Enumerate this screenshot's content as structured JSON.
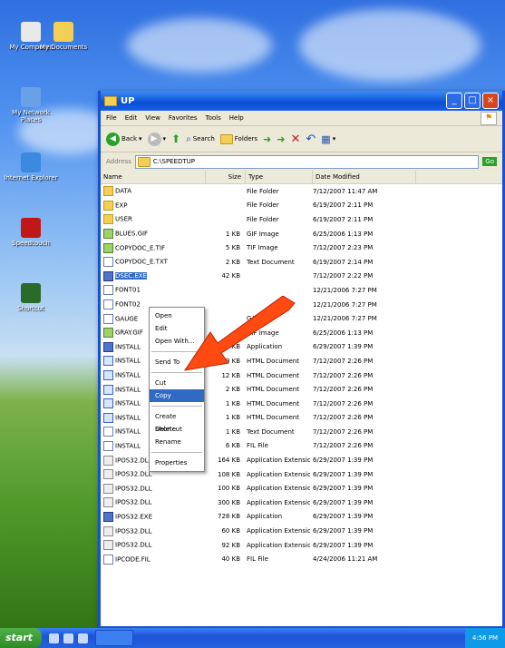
{
  "desktop": {
    "icons": [
      {
        "label": "My Computer",
        "color": "#e9e9e9"
      },
      {
        "label": "My Documents",
        "color": "#f4cf55"
      },
      {
        "label": "My Network Places",
        "color": "#6aa0e8"
      },
      {
        "label": "Internet Explorer",
        "color": "#3c8ae0"
      },
      {
        "label": "Speedtouch",
        "color": "#c01818"
      },
      {
        "label": "Shortcut",
        "color": "#2a6a2a"
      }
    ]
  },
  "window": {
    "title": "UP",
    "menu": [
      "File",
      "Edit",
      "View",
      "Favorites",
      "Tools",
      "Help"
    ],
    "toolbar": {
      "back": "Back",
      "search": "Search",
      "folders": "Folders"
    },
    "address_label": "Address",
    "address_value": "C:\\SPEEDTUP",
    "go_label": "Go",
    "columns": [
      "Name",
      "Size",
      "Type",
      "Date Modified"
    ],
    "files": [
      {
        "name": "DATA",
        "size": "",
        "type": "File Folder",
        "date": "7/12/2007 11:47 AM",
        "icon": "folder"
      },
      {
        "name": "EXP",
        "size": "",
        "type": "File Folder",
        "date": "6/19/2007 2:11 PM",
        "icon": "folder"
      },
      {
        "name": "USER",
        "size": "",
        "type": "File Folder",
        "date": "6/19/2007 2:11 PM",
        "icon": "folder"
      },
      {
        "name": "BLUES.GIF",
        "size": "1 KB",
        "type": "GIF Image",
        "date": "6/25/2006 1:13 PM",
        "icon": "img"
      },
      {
        "name": "COPYDOC_E.TIF",
        "size": "5 KB",
        "type": "TIF Image",
        "date": "7/12/2007 2:23 PM",
        "icon": "img"
      },
      {
        "name": "COPYDOC_E.TXT",
        "size": "2 KB",
        "type": "Text Document",
        "date": "6/19/2007 2:14 PM",
        "icon": "txt"
      },
      {
        "name": "DSEC.EXE",
        "size": "42 KB",
        "type": "",
        "date": "7/12/2007 2:22 PM",
        "icon": "app"
      },
      {
        "name": "FONT01",
        "size": "",
        "type": "",
        "date": "12/21/2006 7:27 PM",
        "icon": "txt"
      },
      {
        "name": "FONT02",
        "size": "",
        "type": "",
        "date": "12/21/2006 7:27 PM",
        "icon": "txt"
      },
      {
        "name": "GAUGE",
        "size": "",
        "type": "GAI File",
        "date": "12/21/2006 7:27 PM",
        "icon": "txt"
      },
      {
        "name": "GRAY.GIF",
        "size": "",
        "type": "GIF Image",
        "date": "6/25/2006 1:13 PM",
        "icon": "img"
      },
      {
        "name": "INSTALL",
        "size": "744 KB",
        "type": "Application",
        "date": "6/29/2007 1:39 PM",
        "icon": "app"
      },
      {
        "name": "INSTALL",
        "size": "19 KB",
        "type": "HTML Document",
        "date": "7/12/2007 2:26 PM",
        "icon": "htm"
      },
      {
        "name": "INSTALL",
        "size": "12 KB",
        "type": "HTML Document",
        "date": "7/12/2007 2:26 PM",
        "icon": "htm"
      },
      {
        "name": "INSTALL",
        "size": "2 KB",
        "type": "HTML Document",
        "date": "7/12/2007 2:26 PM",
        "icon": "htm"
      },
      {
        "name": "INSTALL",
        "size": "1 KB",
        "type": "HTML Document",
        "date": "7/12/2007 2:26 PM",
        "icon": "htm"
      },
      {
        "name": "INSTALL",
        "size": "1 KB",
        "type": "HTML Document",
        "date": "7/12/2007 2:26 PM",
        "icon": "htm"
      },
      {
        "name": "INSTALL",
        "size": "1 KB",
        "type": "Text Document",
        "date": "7/12/2007 2:26 PM",
        "icon": "txt"
      },
      {
        "name": "INSTALL",
        "size": "6 KB",
        "type": "FIL File",
        "date": "7/12/2007 2:26 PM",
        "icon": "txt"
      },
      {
        "name": "IPOS32.DLL",
        "size": "164 KB",
        "type": "Application Extension",
        "date": "6/29/2007 1:39 PM",
        "icon": "dll"
      },
      {
        "name": "IPOS32.DLL",
        "size": "108 KB",
        "type": "Application Extension",
        "date": "6/29/2007 1:39 PM",
        "icon": "dll"
      },
      {
        "name": "IPOS32.DLL",
        "size": "100 KB",
        "type": "Application Extension",
        "date": "6/29/2007 1:39 PM",
        "icon": "dll"
      },
      {
        "name": "IPOS32.DLL",
        "size": "300 KB",
        "type": "Application Extension",
        "date": "6/29/2007 1:39 PM",
        "icon": "dll"
      },
      {
        "name": "IPOS32.EXE",
        "size": "728 KB",
        "type": "Application",
        "date": "6/29/2007 1:39 PM",
        "icon": "app"
      },
      {
        "name": "IPOS32.DLL",
        "size": "60 KB",
        "type": "Application Extension",
        "date": "6/29/2007 1:39 PM",
        "icon": "dll"
      },
      {
        "name": "IPOS32.DLL",
        "size": "92 KB",
        "type": "Application Extension",
        "date": "6/29/2007 1:39 PM",
        "icon": "dll"
      },
      {
        "name": "IPCODE.FIL",
        "size": "40 KB",
        "type": "FIL File",
        "date": "4/24/2006 11:21 AM",
        "icon": "txt"
      }
    ],
    "selected_row": 6
  },
  "context_menu": {
    "items": [
      "Open",
      "Edit",
      "Open With...",
      "—",
      "Send To",
      "—",
      "Cut",
      "Copy",
      "—",
      "Create Shortcut",
      "Delete",
      "Rename",
      "—",
      "Properties"
    ],
    "highlighted": "Copy"
  },
  "annotation": {
    "arrow_color": "#ff4a12"
  },
  "taskbar": {
    "start_label": "start",
    "tray_text": "4:56 PM"
  }
}
